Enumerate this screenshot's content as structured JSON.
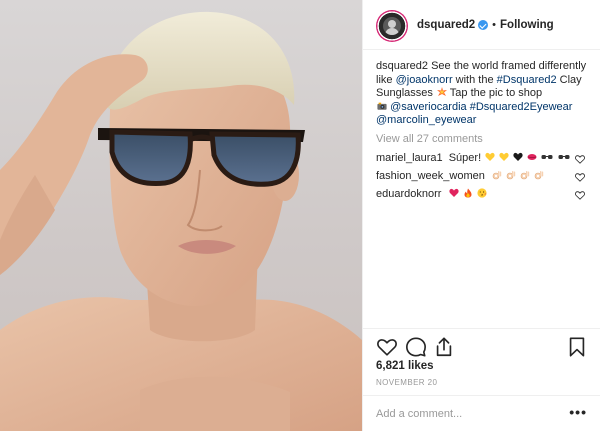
{
  "header": {
    "username": "dsquared2",
    "separator": "•",
    "follow_status": "Following"
  },
  "caption": {
    "username": "dsquared2",
    "text_1": "See the world framed differently like",
    "mention_1": "@joaoknorr",
    "text_2": "with the",
    "hashtag_1": "#Dsquared2",
    "text_3": "Clay Sunglasses",
    "text_4": "Tap the pic to shop",
    "mention_2": "@saveriocardia",
    "hashtag_2": "#Dsquared2Eyewear",
    "mention_3": "@marcolin_eyewear"
  },
  "view_all_comments": "View all 27 comments",
  "comments": [
    {
      "username": "mariel_laura1",
      "text": "Súper!"
    },
    {
      "username": "fashion_week_women",
      "text": ""
    },
    {
      "username": "eduardoknorr",
      "text": ""
    }
  ],
  "likes": "6,821 likes",
  "date": "NOVEMBER 20",
  "add_comment_placeholder": "Add a comment...",
  "more_label": "•••",
  "icons": {
    "like": "heart-icon",
    "comment": "comment-icon",
    "share": "share-icon",
    "save": "bookmark-icon",
    "comment_like": "heart-icon",
    "verified": "verified-badge-icon"
  },
  "colors": {
    "link": "#003569",
    "muted": "#999999",
    "verified": "#3897f0",
    "text": "#262626"
  }
}
